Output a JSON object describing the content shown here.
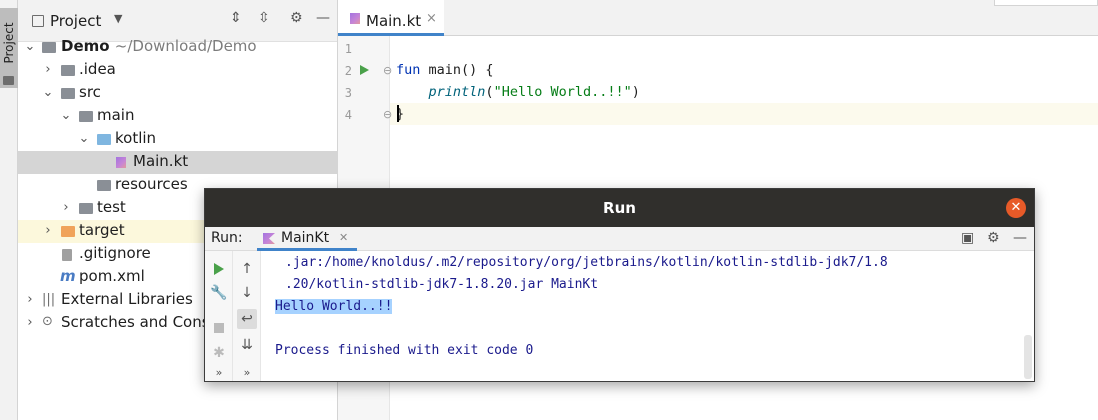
{
  "side_stripe": {
    "tab_label": "Project"
  },
  "project_panel": {
    "title": "Project",
    "tree": [
      {
        "label": "Demo",
        "path": "~/Download/Demo"
      },
      {
        "label": ".idea"
      },
      {
        "label": "src"
      },
      {
        "label": "main"
      },
      {
        "label": "kotlin"
      },
      {
        "label": "Main.kt"
      },
      {
        "label": "resources"
      },
      {
        "label": "test"
      },
      {
        "label": "target"
      },
      {
        "label": ".gitignore"
      },
      {
        "label": "pom.xml"
      },
      {
        "label": "External Libraries"
      },
      {
        "label": "Scratches and Conso"
      }
    ]
  },
  "editor": {
    "tab_label": "Main.kt",
    "lines": [
      {
        "n": "1"
      },
      {
        "n": "2",
        "kw": "fun",
        "rest": " main() {"
      },
      {
        "n": "3",
        "fn": "println",
        "open": "(",
        "str": "\"Hello World..!!\"",
        "close": ")"
      },
      {
        "n": "4",
        "text": "}"
      }
    ]
  },
  "run_dialog": {
    "title": "Run",
    "run_label": "Run:",
    "tab_label": "MainKt",
    "console": [
      ".jar:/home/knoldus/.m2/repository/org/jetbrains/kotlin/kotlin-stdlib-jdk7/1.8",
      ".20/kotlin-stdlib-jdk7-1.8.20.jar MainKt",
      "Hello World..!!",
      "Process finished with exit code 0"
    ]
  },
  "colors": {
    "accent": "#4083c9",
    "run_green": "#4aa14a",
    "dialog_titlebar": "#302f2c",
    "close_button": "#e75a28",
    "selection": "#a6d2ff"
  }
}
